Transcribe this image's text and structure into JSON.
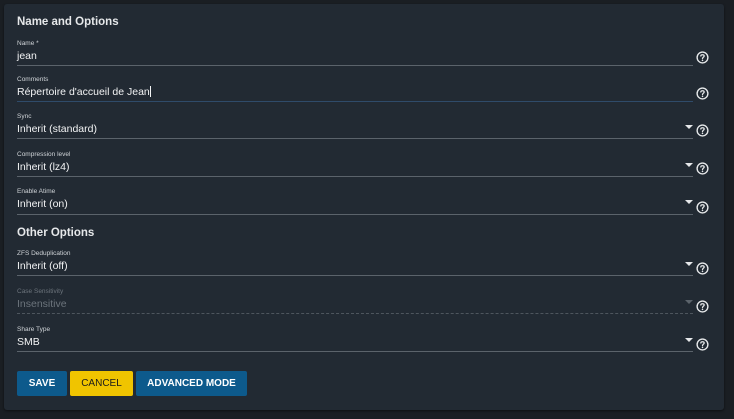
{
  "sections": {
    "name_options_title": "Name and Options",
    "other_options_title": "Other Options"
  },
  "fields": {
    "name": {
      "label": "Name *",
      "value": "jean"
    },
    "comments": {
      "label": "Comments",
      "value": "Répertoire d'accueil de Jean"
    },
    "sync": {
      "label": "Sync",
      "value": "Inherit (standard)"
    },
    "compression": {
      "label": "Compression level",
      "value": "Inherit (lz4)"
    },
    "atime": {
      "label": "Enable Atime",
      "value": "Inherit (on)"
    },
    "dedup": {
      "label": "ZFS Deduplication",
      "value": "Inherit (off)"
    },
    "case_sensitivity": {
      "label": "Case Sensitivity",
      "value": "Insensitive"
    },
    "share_type": {
      "label": "Share Type",
      "value": "SMB"
    }
  },
  "buttons": {
    "save": "SAVE",
    "cancel": "CANCEL",
    "advanced": "ADVANCED MODE"
  },
  "icons": {
    "help": "help-circle-icon",
    "dropdown": "triangle-down-icon"
  },
  "colors": {
    "primary": "#0d5a8c",
    "accent": "#f0c400",
    "background": "#222a33"
  }
}
